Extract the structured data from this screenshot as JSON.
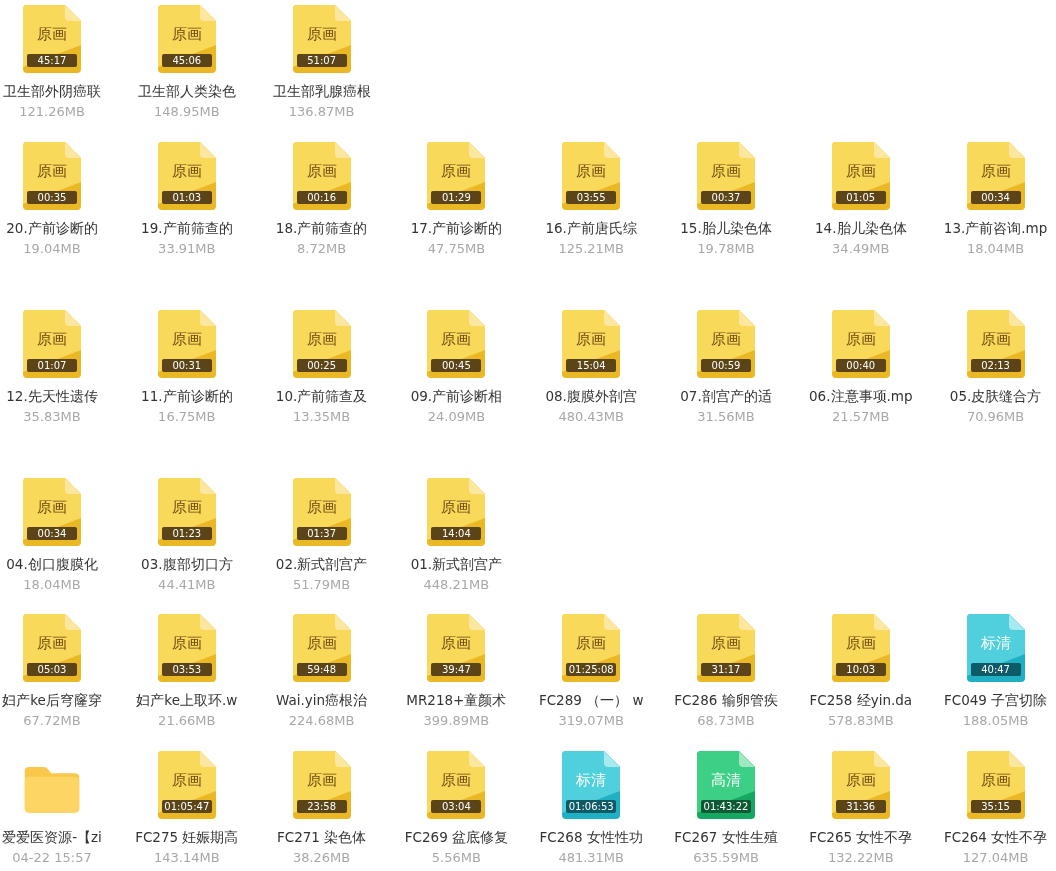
{
  "rows": [
    {
      "items": [
        {
          "kind": "original",
          "badge": "原画",
          "duration": "45:17",
          "name": "卫生部外阴癌联",
          "detail": "121.26MB"
        },
        {
          "kind": "original",
          "badge": "原画",
          "duration": "45:06",
          "name": "卫生部人类染色",
          "detail": "148.95MB"
        },
        {
          "kind": "original",
          "badge": "原画",
          "duration": "51:07",
          "name": "卫生部乳腺癌根",
          "detail": "136.87MB"
        }
      ]
    },
    {
      "items": [
        {
          "kind": "original",
          "badge": "原画",
          "duration": "00:35",
          "name": "20.产前诊断的",
          "detail": "19.04MB"
        },
        {
          "kind": "original",
          "badge": "原画",
          "duration": "01:03",
          "name": "19.产前筛查的",
          "detail": "33.91MB"
        },
        {
          "kind": "original",
          "badge": "原画",
          "duration": "00:16",
          "name": "18.产前筛查的",
          "detail": "8.72MB"
        },
        {
          "kind": "original",
          "badge": "原画",
          "duration": "01:29",
          "name": "17.产前诊断的",
          "detail": "47.75MB"
        },
        {
          "kind": "original",
          "badge": "原画",
          "duration": "03:55",
          "name": "16.产前唐氏综",
          "detail": "125.21MB"
        },
        {
          "kind": "original",
          "badge": "原画",
          "duration": "00:37",
          "name": "15.胎儿染色体",
          "detail": "19.78MB"
        },
        {
          "kind": "original",
          "badge": "原画",
          "duration": "01:05",
          "name": "14.胎儿染色体",
          "detail": "34.49MB"
        },
        {
          "kind": "original",
          "badge": "原画",
          "duration": "00:34",
          "name": "13.产前咨询.mp",
          "detail": "18.04MB"
        }
      ]
    },
    {
      "items": [
        {
          "kind": "original",
          "badge": "原画",
          "duration": "01:07",
          "name": "12.先天性遗传",
          "detail": "35.83MB"
        },
        {
          "kind": "original",
          "badge": "原画",
          "duration": "00:31",
          "name": "11.产前诊断的",
          "detail": "16.75MB"
        },
        {
          "kind": "original",
          "badge": "原画",
          "duration": "00:25",
          "name": "10.产前筛查及",
          "detail": "13.35MB"
        },
        {
          "kind": "original",
          "badge": "原画",
          "duration": "00:45",
          "name": "09.产前诊断相",
          "detail": "24.09MB"
        },
        {
          "kind": "original",
          "badge": "原画",
          "duration": "15:04",
          "name": "08.腹膜外剖宫",
          "detail": "480.43MB"
        },
        {
          "kind": "original",
          "badge": "原画",
          "duration": "00:59",
          "name": "07.剖宫产的适",
          "detail": "31.56MB"
        },
        {
          "kind": "original",
          "badge": "原画",
          "duration": "00:40",
          "name": "06.注意事项.mp",
          "detail": "21.57MB"
        },
        {
          "kind": "original",
          "badge": "原画",
          "duration": "02:13",
          "name": "05.皮肤缝合方",
          "detail": "70.96MB"
        }
      ]
    },
    {
      "items": [
        {
          "kind": "original",
          "badge": "原画",
          "duration": "00:34",
          "name": "04.创口腹膜化",
          "detail": "18.04MB"
        },
        {
          "kind": "original",
          "badge": "原画",
          "duration": "01:23",
          "name": "03.腹部切口方",
          "detail": "44.41MB"
        },
        {
          "kind": "original",
          "badge": "原画",
          "duration": "01:37",
          "name": "02.新式剖宫产",
          "detail": "51.79MB"
        },
        {
          "kind": "original",
          "badge": "原画",
          "duration": "14:04",
          "name": "01.新式剖宫产",
          "detail": "448.21MB"
        }
      ]
    },
    {
      "items": [
        {
          "kind": "original",
          "badge": "原画",
          "duration": "05:03",
          "name": "妇产ke后穹窿穿",
          "detail": "67.72MB"
        },
        {
          "kind": "original",
          "badge": "原画",
          "duration": "03:53",
          "name": "妇产ke上取环.w",
          "detail": "21.66MB"
        },
        {
          "kind": "original",
          "badge": "原画",
          "duration": "59:48",
          "name": "Wai.yin癌根治",
          "detail": "224.68MB"
        },
        {
          "kind": "original",
          "badge": "原画",
          "duration": "39:47",
          "name": "MR218+童颜术",
          "detail": "399.89MB"
        },
        {
          "kind": "original",
          "badge": "原画",
          "duration": "01:25:08",
          "name": "FC289 （一） w",
          "detail": "319.07MB"
        },
        {
          "kind": "original",
          "badge": "原画",
          "duration": "31:17",
          "name": "FC286 输卵管疾",
          "detail": "68.73MB"
        },
        {
          "kind": "original",
          "badge": "原画",
          "duration": "10:03",
          "name": "FC258 经yin.da",
          "detail": "578.83MB"
        },
        {
          "kind": "sd",
          "badge": "标清",
          "duration": "40:47",
          "name": "FC049 子宫切除",
          "detail": "188.05MB"
        }
      ]
    },
    {
      "items": [
        {
          "kind": "folder",
          "name": "爱爱医资源-【zi",
          "detail": "04-22 15:57"
        },
        {
          "kind": "original",
          "badge": "原画",
          "duration": "01:05:47",
          "name": "FC275 妊娠期高",
          "detail": "143.14MB"
        },
        {
          "kind": "original",
          "badge": "原画",
          "duration": "23:58",
          "name": "FC271 染色体",
          "detail": "38.26MB"
        },
        {
          "kind": "original",
          "badge": "原画",
          "duration": "03:04",
          "name": "FC269 盆底修复",
          "detail": "5.56MB"
        },
        {
          "kind": "sd",
          "badge": "标清",
          "duration": "01:06:53",
          "name": "FC268 女性性功",
          "detail": "481.31MB"
        },
        {
          "kind": "hd",
          "badge": "高清",
          "duration": "01:43:22",
          "name": "FC267 女性生殖",
          "detail": "635.59MB"
        },
        {
          "kind": "original",
          "badge": "原画",
          "duration": "31:36",
          "name": "FC265 女性不孕",
          "detail": "132.22MB"
        },
        {
          "kind": "original",
          "badge": "原画",
          "duration": "35:15",
          "name": "FC264 女性不孕",
          "detail": "127.04MB"
        }
      ]
    }
  ]
}
